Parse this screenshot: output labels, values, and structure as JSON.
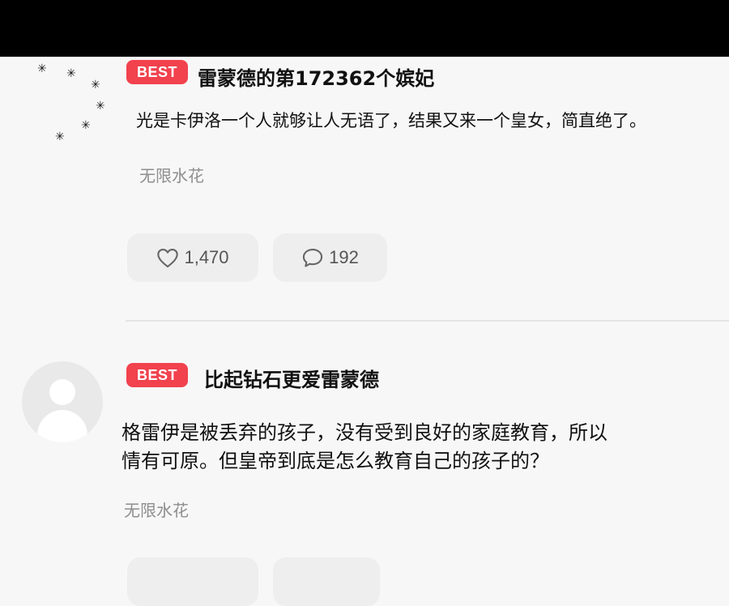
{
  "comments": [
    {
      "badge": "BEST",
      "username": "雷蒙德的第172362个嫔妃",
      "text_lines": [
        "光是卡伊洛一个人就够让人无语了，结果又来一个皇女，简直绝了。"
      ],
      "source": "无限水花",
      "likes": "1,470",
      "replies": "192",
      "avatar_icon": "ants-icon"
    },
    {
      "badge": "BEST",
      "username": "比起钻石更爱雷蒙德",
      "text_lines": [
        "格雷伊是被丢弃的孩子，没有受到良好的家庭教育，所以",
        "情有可原。但皇帝到底是怎么教育自己的孩子的？"
      ],
      "source": "无限水花",
      "avatar_icon": "default-user-icon"
    }
  ],
  "colors": {
    "badge": "#f1424e",
    "pill": "#eeeeee",
    "top_bar": "#000000",
    "muted_text": "#8e8e8e"
  }
}
